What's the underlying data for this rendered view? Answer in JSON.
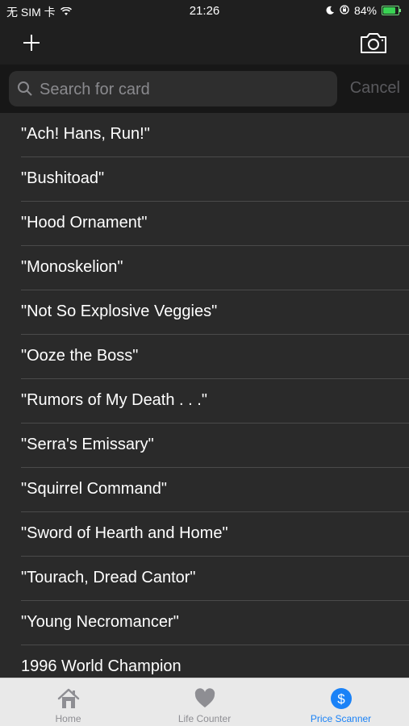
{
  "status_bar": {
    "carrier": "无 SIM 卡",
    "time": "21:26",
    "battery_percent_label": "84%",
    "battery_level": 0.84
  },
  "nav": {
    "add_icon": "plus-icon",
    "camera_icon": "camera-icon"
  },
  "search": {
    "placeholder": "Search for card",
    "value": "",
    "cancel_label": "Cancel"
  },
  "cards": [
    "\"Ach! Hans, Run!\"",
    "\"Bushitoad\"",
    "\"Hood Ornament\"",
    "\"Monoskelion\"",
    "\"Not So Explosive Veggies\"",
    "\"Ooze the Boss\"",
    "\"Rumors of My Death . . .\"",
    "\"Serra's Emissary\"",
    "\"Squirrel Command\"",
    "\"Sword of Hearth and Home\"",
    "\"Tourach, Dread Cantor\"",
    "\"Young Necromancer\"",
    "1996 World Champion"
  ],
  "tabs": [
    {
      "label": "Home",
      "icon": "house-icon",
      "active": false
    },
    {
      "label": "Life Counter",
      "icon": "heart-icon",
      "active": false
    },
    {
      "label": "Price Scanner",
      "icon": "dollar-icon",
      "active": true
    }
  ],
  "colors": {
    "accent": "#1a82f7",
    "background": "#2a2a2a",
    "tab_bar": "#e9e9e9"
  }
}
